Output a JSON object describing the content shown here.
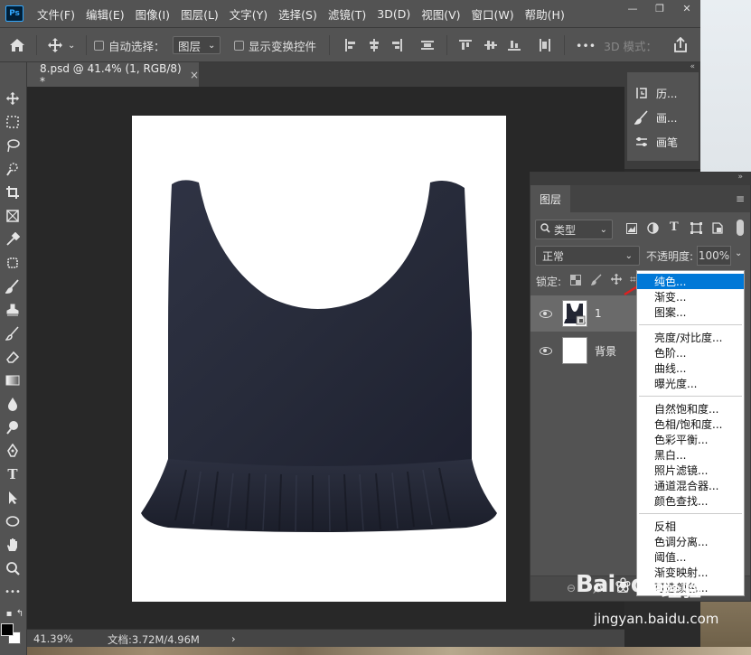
{
  "menubar": {
    "logo": "Ps",
    "items": [
      "文件(F)",
      "编辑(E)",
      "图像(I)",
      "图层(L)",
      "文字(Y)",
      "选择(S)",
      "滤镜(T)",
      "3D(D)",
      "视图(V)",
      "窗口(W)",
      "帮助(H)"
    ],
    "win": [
      "—",
      "❐",
      "✕"
    ]
  },
  "options": {
    "auto_select_label": "自动选择：",
    "auto_select_target": "图层",
    "show_transform_label": "显示变换控件",
    "more": "•••",
    "mode_3d": "3D 模式：",
    "colors": {
      "bg": "#535353",
      "accent": "#31a8ff"
    }
  },
  "document_tab": {
    "title": "8.psd @ 41.4% (1, RGB/8) *",
    "close": "×"
  },
  "status": {
    "zoom": "41.39%",
    "doc_size": "文档:3.72M/4.96M",
    "arrow": "›"
  },
  "dock": {
    "items": [
      "历...",
      "画...",
      "画笔"
    ]
  },
  "layers_panel": {
    "tab": "图层",
    "filter": "类型",
    "filter_icon": "search-icon",
    "blend_mode": "正常",
    "opacity_label": "不透明度:",
    "opacity_value": "100%",
    "lock_label": "锁定:",
    "layers": [
      {
        "name": "1",
        "visible": true
      },
      {
        "name": "背景",
        "visible": true
      }
    ]
  },
  "adjustment_menu": {
    "groups": [
      [
        "纯色...",
        "渐变...",
        "图案..."
      ],
      [
        "亮度/对比度...",
        "色阶...",
        "曲线...",
        "曝光度..."
      ],
      [
        "自然饱和度...",
        "色相/饱和度...",
        "色彩平衡...",
        "黑白...",
        "照片滤镜...",
        "通道混合器...",
        "颜色查找..."
      ],
      [
        "反相",
        "色调分离...",
        "阈值...",
        "渐变映射...",
        "可选颜色..."
      ]
    ],
    "selected": "纯色...",
    "selected_color": "#0078d7"
  },
  "watermark": {
    "brand": "Bai",
    "brand2": "du",
    "jingyan": "经验",
    "url": "jingyan.baidu.com"
  }
}
